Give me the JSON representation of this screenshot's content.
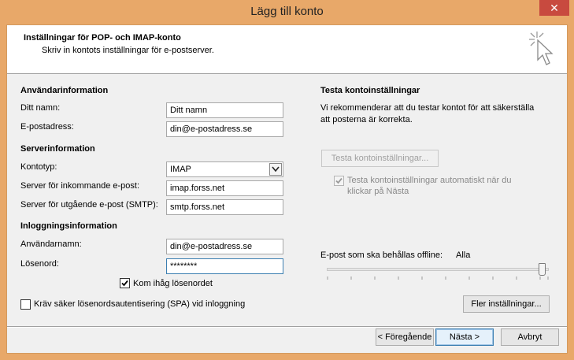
{
  "window": {
    "title": "Lägg till konto",
    "close_glyph": "✕"
  },
  "header": {
    "title": "Inställningar för POP- och IMAP-konto",
    "subtitle": "Skriv in kontots inställningar för e-postserver."
  },
  "user_info": {
    "heading": "Användarinformation",
    "name_label": "Ditt namn:",
    "name_value": "Ditt namn",
    "email_label": "E-postadress:",
    "email_value": "din@e-postadress.se"
  },
  "server_info": {
    "heading": "Serverinformation",
    "account_type_label": "Kontotyp:",
    "account_type_value": "IMAP",
    "incoming_label": "Server för inkommande e-post:",
    "incoming_value": "imap.forss.net",
    "outgoing_label": "Server för utgående e-post (SMTP):",
    "outgoing_value": "smtp.forss.net"
  },
  "login_info": {
    "heading": "Inloggningsinformation",
    "username_label": "Användarnamn:",
    "username_value": "din@e-postadress.se",
    "password_label": "Lösenord:",
    "password_value": "********",
    "remember_label": "Kom ihåg lösenordet",
    "remember_checked": true,
    "spa_label": "Kräv säker lösenordsautentisering (SPA) vid inloggning",
    "spa_checked": false
  },
  "test": {
    "heading": "Testa kontoinställningar",
    "description_line1": "Vi rekommenderar att du testar kontot för att säkerställa",
    "description_line2": "att posterna är korrekta.",
    "button_label": "Testa kontoinställningar...",
    "auto_test_line1": "Testa kontoinställningar automatiskt när du",
    "auto_test_line2": "klickar på Nästa",
    "auto_test_checked": true
  },
  "offline": {
    "label": "E-post som ska behållas offline:",
    "value": "Alla",
    "slider_level": 1.0
  },
  "buttons": {
    "more_settings": "Fler inställningar...",
    "back": "< Föregående",
    "next": "Nästa >",
    "cancel": "Avbryt"
  },
  "colors": {
    "titlebar": "#e8a869",
    "close_button": "#c84a3f",
    "focus_border": "#3c7fb1"
  },
  "icons": {
    "header": "cursor-sparkle-icon",
    "dropdown": "chevron-down-icon",
    "check": "checkmark-icon"
  }
}
